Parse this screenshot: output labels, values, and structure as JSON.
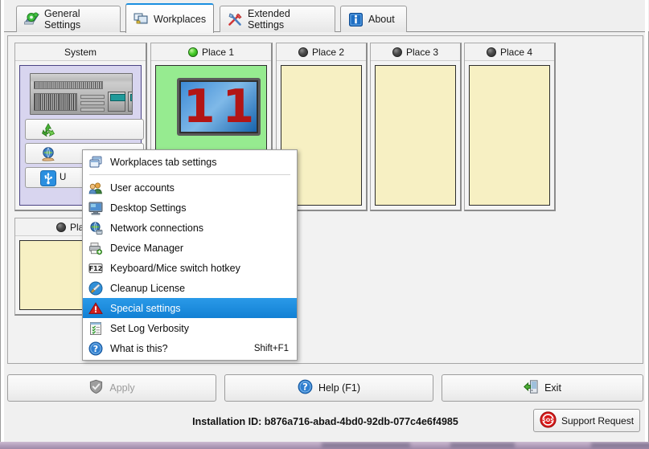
{
  "window": {
    "tabs": [
      {
        "label": "General Settings",
        "icon": "general-settings-icon",
        "active": false
      },
      {
        "label": "Workplaces",
        "icon": "workplaces-icon",
        "active": true
      },
      {
        "label": "Extended Settings",
        "icon": "extended-settings-icon",
        "active": false
      },
      {
        "label": "About",
        "icon": "about-info-icon",
        "active": false
      }
    ]
  },
  "workplaces": {
    "system_card": {
      "title": "System",
      "buttons": [
        {
          "label": "",
          "icon": "recycle-icon"
        },
        {
          "label": "",
          "icon": "globe-in-hand-icon"
        },
        {
          "label": "U",
          "icon": "usb-icon"
        }
      ]
    },
    "places": [
      {
        "label": "Place 1",
        "status": "on",
        "screen_number": "11"
      },
      {
        "label": "Place 2",
        "status": "off",
        "screen_number": ""
      },
      {
        "label": "Place 3",
        "status": "off",
        "screen_number": ""
      },
      {
        "label": "Place 4",
        "status": "off",
        "screen_number": ""
      },
      {
        "label": "Place",
        "status": "off",
        "screen_number": ""
      }
    ]
  },
  "context_menu": {
    "items": [
      {
        "label": "Workplaces tab settings",
        "icon": "copy-windows-icon",
        "shortcut": "",
        "selected": false,
        "separator_after": true
      },
      {
        "label": "User accounts",
        "icon": "users-icon",
        "shortcut": "",
        "selected": false,
        "separator_after": false
      },
      {
        "label": "Desktop Settings",
        "icon": "desktop-icon",
        "shortcut": "",
        "selected": false,
        "separator_after": false
      },
      {
        "label": "Network connections",
        "icon": "network-globe-icon",
        "shortcut": "",
        "selected": false,
        "separator_after": false
      },
      {
        "label": "Device Manager",
        "icon": "device-printer-icon",
        "shortcut": "",
        "selected": false,
        "separator_after": false
      },
      {
        "label": "Keyboard/Mice switch hotkey",
        "icon": "f12-key-icon",
        "shortcut": "",
        "selected": false,
        "separator_after": false
      },
      {
        "label": "Cleanup License",
        "icon": "broom-icon",
        "shortcut": "",
        "selected": false,
        "separator_after": false
      },
      {
        "label": "Special settings",
        "icon": "warning-triangle-icon",
        "shortcut": "",
        "selected": true,
        "separator_after": false
      },
      {
        "label": "Set Log Verbosity",
        "icon": "checklist-icon",
        "shortcut": "",
        "selected": false,
        "separator_after": false
      },
      {
        "label": "What is this?",
        "icon": "help-question-icon",
        "shortcut": "Shift+F1",
        "selected": false,
        "separator_after": false
      }
    ]
  },
  "footer": {
    "apply_label": "Apply",
    "apply_icon": "shield-check-icon",
    "apply_disabled": true,
    "help_label": "Help (F1)",
    "help_icon": "help-question-icon",
    "exit_label": "Exit",
    "exit_icon": "exit-door-icon",
    "installation_id_text": "Installation ID: b876a716-abad-4bd0-92db-077c4e6f4985",
    "support_label": "Support Request",
    "support_icon": "sos-icon"
  },
  "colors": {
    "accent_blue": "#1a8fe0",
    "menu_highlight": "#2196e8",
    "place_empty": "#f7f0c3",
    "place_active": "#96eb90",
    "system_bg": "#d8d5ef",
    "warning_red": "#c01616"
  }
}
